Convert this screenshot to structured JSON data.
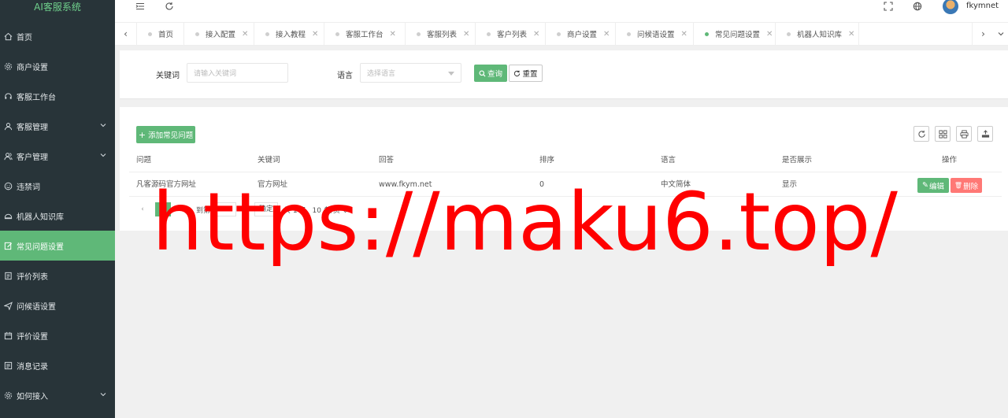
{
  "app": {
    "brand": "AI客服系统"
  },
  "sidebar": {
    "items": [
      {
        "label": "首页",
        "icon": "home-icon",
        "expandable": false
      },
      {
        "label": "商户设置",
        "icon": "gear-icon",
        "expandable": false
      },
      {
        "label": "客服工作台",
        "icon": "headset-icon",
        "expandable": false
      },
      {
        "label": "客服管理",
        "icon": "user-icon",
        "expandable": true
      },
      {
        "label": "客户管理",
        "icon": "users-icon",
        "expandable": true
      },
      {
        "label": "违禁词",
        "icon": "smiley-icon",
        "expandable": false
      },
      {
        "label": "机器人知识库",
        "icon": "robot-icon",
        "expandable": false
      },
      {
        "label": "常见问题设置",
        "icon": "edit-icon",
        "expandable": false,
        "active": true
      },
      {
        "label": "评价列表",
        "icon": "doc-icon",
        "expandable": false
      },
      {
        "label": "问候语设置",
        "icon": "send-icon",
        "expandable": false
      },
      {
        "label": "评价设置",
        "icon": "calendar-icon",
        "expandable": false
      },
      {
        "label": "消息记录",
        "icon": "log-icon",
        "expandable": false
      },
      {
        "label": "如何接入",
        "icon": "plug-icon",
        "expandable": true
      }
    ]
  },
  "header": {
    "username": "fkymnet",
    "icons": [
      "menu-toggle-icon",
      "refresh-icon",
      "fullscreen-icon",
      "globe-icon"
    ]
  },
  "tabs": [
    {
      "label": "首页",
      "closable": false
    },
    {
      "label": "接入配置",
      "closable": true
    },
    {
      "label": "接入教程",
      "closable": true
    },
    {
      "label": "客服工作台",
      "closable": true
    },
    {
      "label": "客服列表",
      "closable": true
    },
    {
      "label": "客户列表",
      "closable": true
    },
    {
      "label": "商户设置",
      "closable": true
    },
    {
      "label": "问候语设置",
      "closable": true
    },
    {
      "label": "常见问题设置",
      "closable": true,
      "active": true
    },
    {
      "label": "机器人知识库",
      "closable": true
    }
  ],
  "search": {
    "keyword_label": "关键词",
    "keyword_placeholder": "请输入关键词",
    "language_label": "语言",
    "language_placeholder": "选择语言",
    "query_label": "查询",
    "reset_label": "重置"
  },
  "toolbar": {
    "add_label": "添加常见问题"
  },
  "table": {
    "columns": [
      "问题",
      "关键词",
      "回答",
      "排序",
      "语言",
      "是否展示",
      "操作"
    ],
    "rows": [
      {
        "question": "凡客源码官方网址",
        "keyword": "官方网址",
        "answer": "www.fkym.net",
        "sort": "0",
        "language": "中文简体",
        "show": "显示",
        "edit": "编辑",
        "delete": "删除"
      }
    ]
  },
  "pagination": {
    "current_page": "1",
    "goto_label": "到第",
    "goto_value": "1",
    "page_suffix": "页",
    "confirm_label": "确定",
    "total_label": "共 1 条",
    "page_size": "10 条/页"
  },
  "watermark": "https://maku6.top/",
  "colors": {
    "sidebar_bg": "#283439",
    "accent": "#5fb878",
    "danger": "#ff7875",
    "watermark": "#ff0000"
  }
}
